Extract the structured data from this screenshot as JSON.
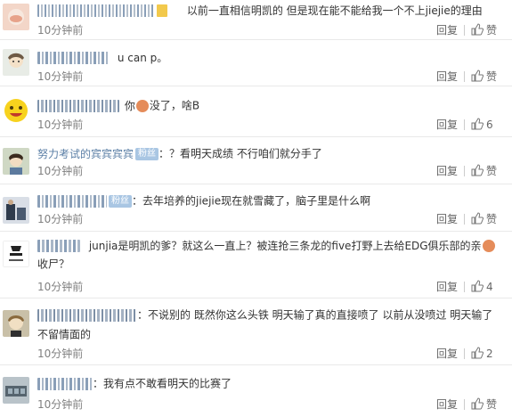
{
  "comments": [
    {
      "username": "(blurred username)",
      "text": "以前一直相信明凯的 但是现在能不能给我一个不上jiejie的理由",
      "time": "10分钟前",
      "reply": "回复",
      "like": "赞"
    },
    {
      "username": "(blurred username)",
      "text": "u can p。",
      "time": "10分钟前",
      "reply": "回复",
      "like": "赞"
    },
    {
      "username": "(blurred username)",
      "text_before": "你",
      "text_after": "没了，啥B",
      "time": "10分钟前",
      "reply": "回复",
      "like_count": "6"
    },
    {
      "username": "努力考试的宾宾宾宾",
      "badge": "粉丝",
      "text": "？看明天成绩 不行咱们就分手了",
      "time": "10分钟前",
      "reply": "回复",
      "like": "赞"
    },
    {
      "username": "(blurred username)",
      "badge": "粉丝",
      "text": "去年培养的jiejie现在就雪藏了，脑子里是什么啊",
      "time": "10分钟前",
      "reply": "回复",
      "like": "赞"
    },
    {
      "username": "(blurred username)",
      "text_before": "junjia是明凯的爹？就这么一直上？被连抢三条龙的five打野上去给EDG俱乐部的亲",
      "text_line2": "收尸？",
      "time": "10分钟前",
      "reply": "回复",
      "like_count": "4"
    },
    {
      "username": "(blurred username)",
      "text": "不说别的 既然你这么头铁 明天输了真的直接喷了 以前从没喷过 明天输了",
      "text_line2": "不留情面的",
      "time": "10分钟前",
      "reply": "回复",
      "like_count": "2"
    },
    {
      "username": "(blurred username)",
      "text": "我有点不敢看明天的比赛了",
      "time": "10分钟前",
      "reply": "回复",
      "like": "赞"
    }
  ],
  "colors": {
    "username_blur": "#8a9fb8",
    "badge": "#a9c6e3",
    "time": "#808080"
  }
}
